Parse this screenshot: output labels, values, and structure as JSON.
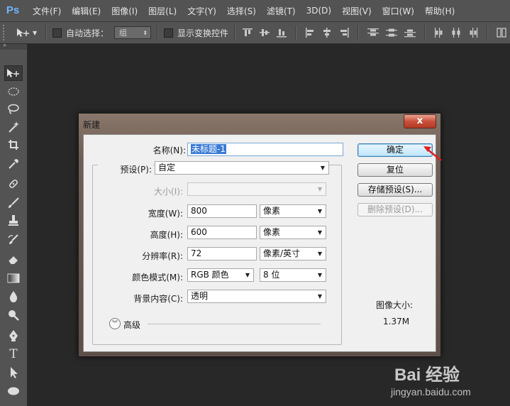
{
  "app": {
    "logo": "Ps"
  },
  "menu": [
    "文件(F)",
    "编辑(E)",
    "图像(I)",
    "图层(L)",
    "文字(Y)",
    "选择(S)",
    "滤镜(T)",
    "3D(D)",
    "视图(V)",
    "窗口(W)",
    "帮助(H)"
  ],
  "options_bar": {
    "auto_select_label": "自动选择：",
    "auto_select_value": "组",
    "show_transform_label": "显示变换控件"
  },
  "dialog": {
    "title": "新建",
    "close_label": "x",
    "name_label": "名称(N):",
    "name_value": "未标题-1",
    "preset_label": "预设(P):",
    "preset_value": "自定",
    "size_label": "大小(I):",
    "width_label": "宽度(W):",
    "width_value": "800",
    "width_unit": "像素",
    "height_label": "高度(H):",
    "height_value": "600",
    "height_unit": "像素",
    "resolution_label": "分辨率(R):",
    "resolution_value": "72",
    "resolution_unit": "像素/英寸",
    "color_mode_label": "颜色模式(M):",
    "color_mode_value": "RGB 颜色",
    "bit_depth_value": "8 位",
    "background_label": "背景内容(C):",
    "background_value": "透明",
    "advanced_label": "高级",
    "ok_label": "确定",
    "reset_label": "复位",
    "save_preset_label": "存储预设(S)...",
    "delete_preset_label": "删除预设(D)...",
    "image_size_label": "图像大小:",
    "image_size_value": "1.37M"
  },
  "watermark": {
    "logo": "Bai 经验",
    "url": "jingyan.baidu.com"
  },
  "colors": {
    "accent": "#3a7bd5",
    "annotation_arrow": "#e02020",
    "workspace": "#282828",
    "panel": "#535353"
  }
}
